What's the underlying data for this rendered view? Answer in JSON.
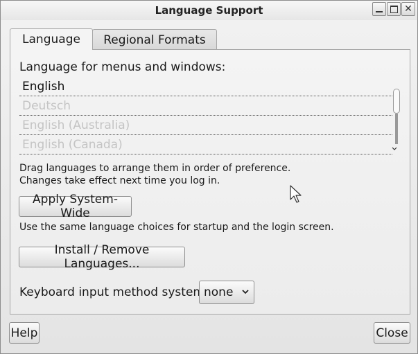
{
  "window": {
    "title": "Language Support",
    "buttons": [
      "minimize",
      "maximize",
      "close"
    ]
  },
  "tabs": [
    {
      "label": "Language",
      "active": true
    },
    {
      "label": "Regional Formats",
      "active": false
    }
  ],
  "language_tab": {
    "section_label": "Language for menus and windows:",
    "languages": [
      {
        "label": "English",
        "active": true
      },
      {
        "label": "Deutsch",
        "active": false
      },
      {
        "label": "English (Australia)",
        "active": false
      },
      {
        "label": "English (Canada)",
        "active": false
      }
    ],
    "drag_hint_line1": "Drag languages to arrange them in order of preference.",
    "drag_hint_line2": "Changes take effect next time you log in.",
    "apply_button_label": "Apply System-Wide",
    "apply_description": "Use the same language choices for startup and the login screen.",
    "install_button_label": "Install / Remove Languages...",
    "keyboard_label": "Keyboard input method system:",
    "keyboard_value": "none"
  },
  "footer": {
    "help_label": "Help",
    "close_label": "Close"
  },
  "icons": {
    "minimize": "minimize-icon",
    "maximize": "maximize-icon",
    "close": "close-icon",
    "dropdown": "chevron-down-icon",
    "cursor": "mouse-pointer-icon"
  },
  "colors": {
    "inactive_text": "#c4c4c4",
    "border": "#a7a7a7"
  }
}
